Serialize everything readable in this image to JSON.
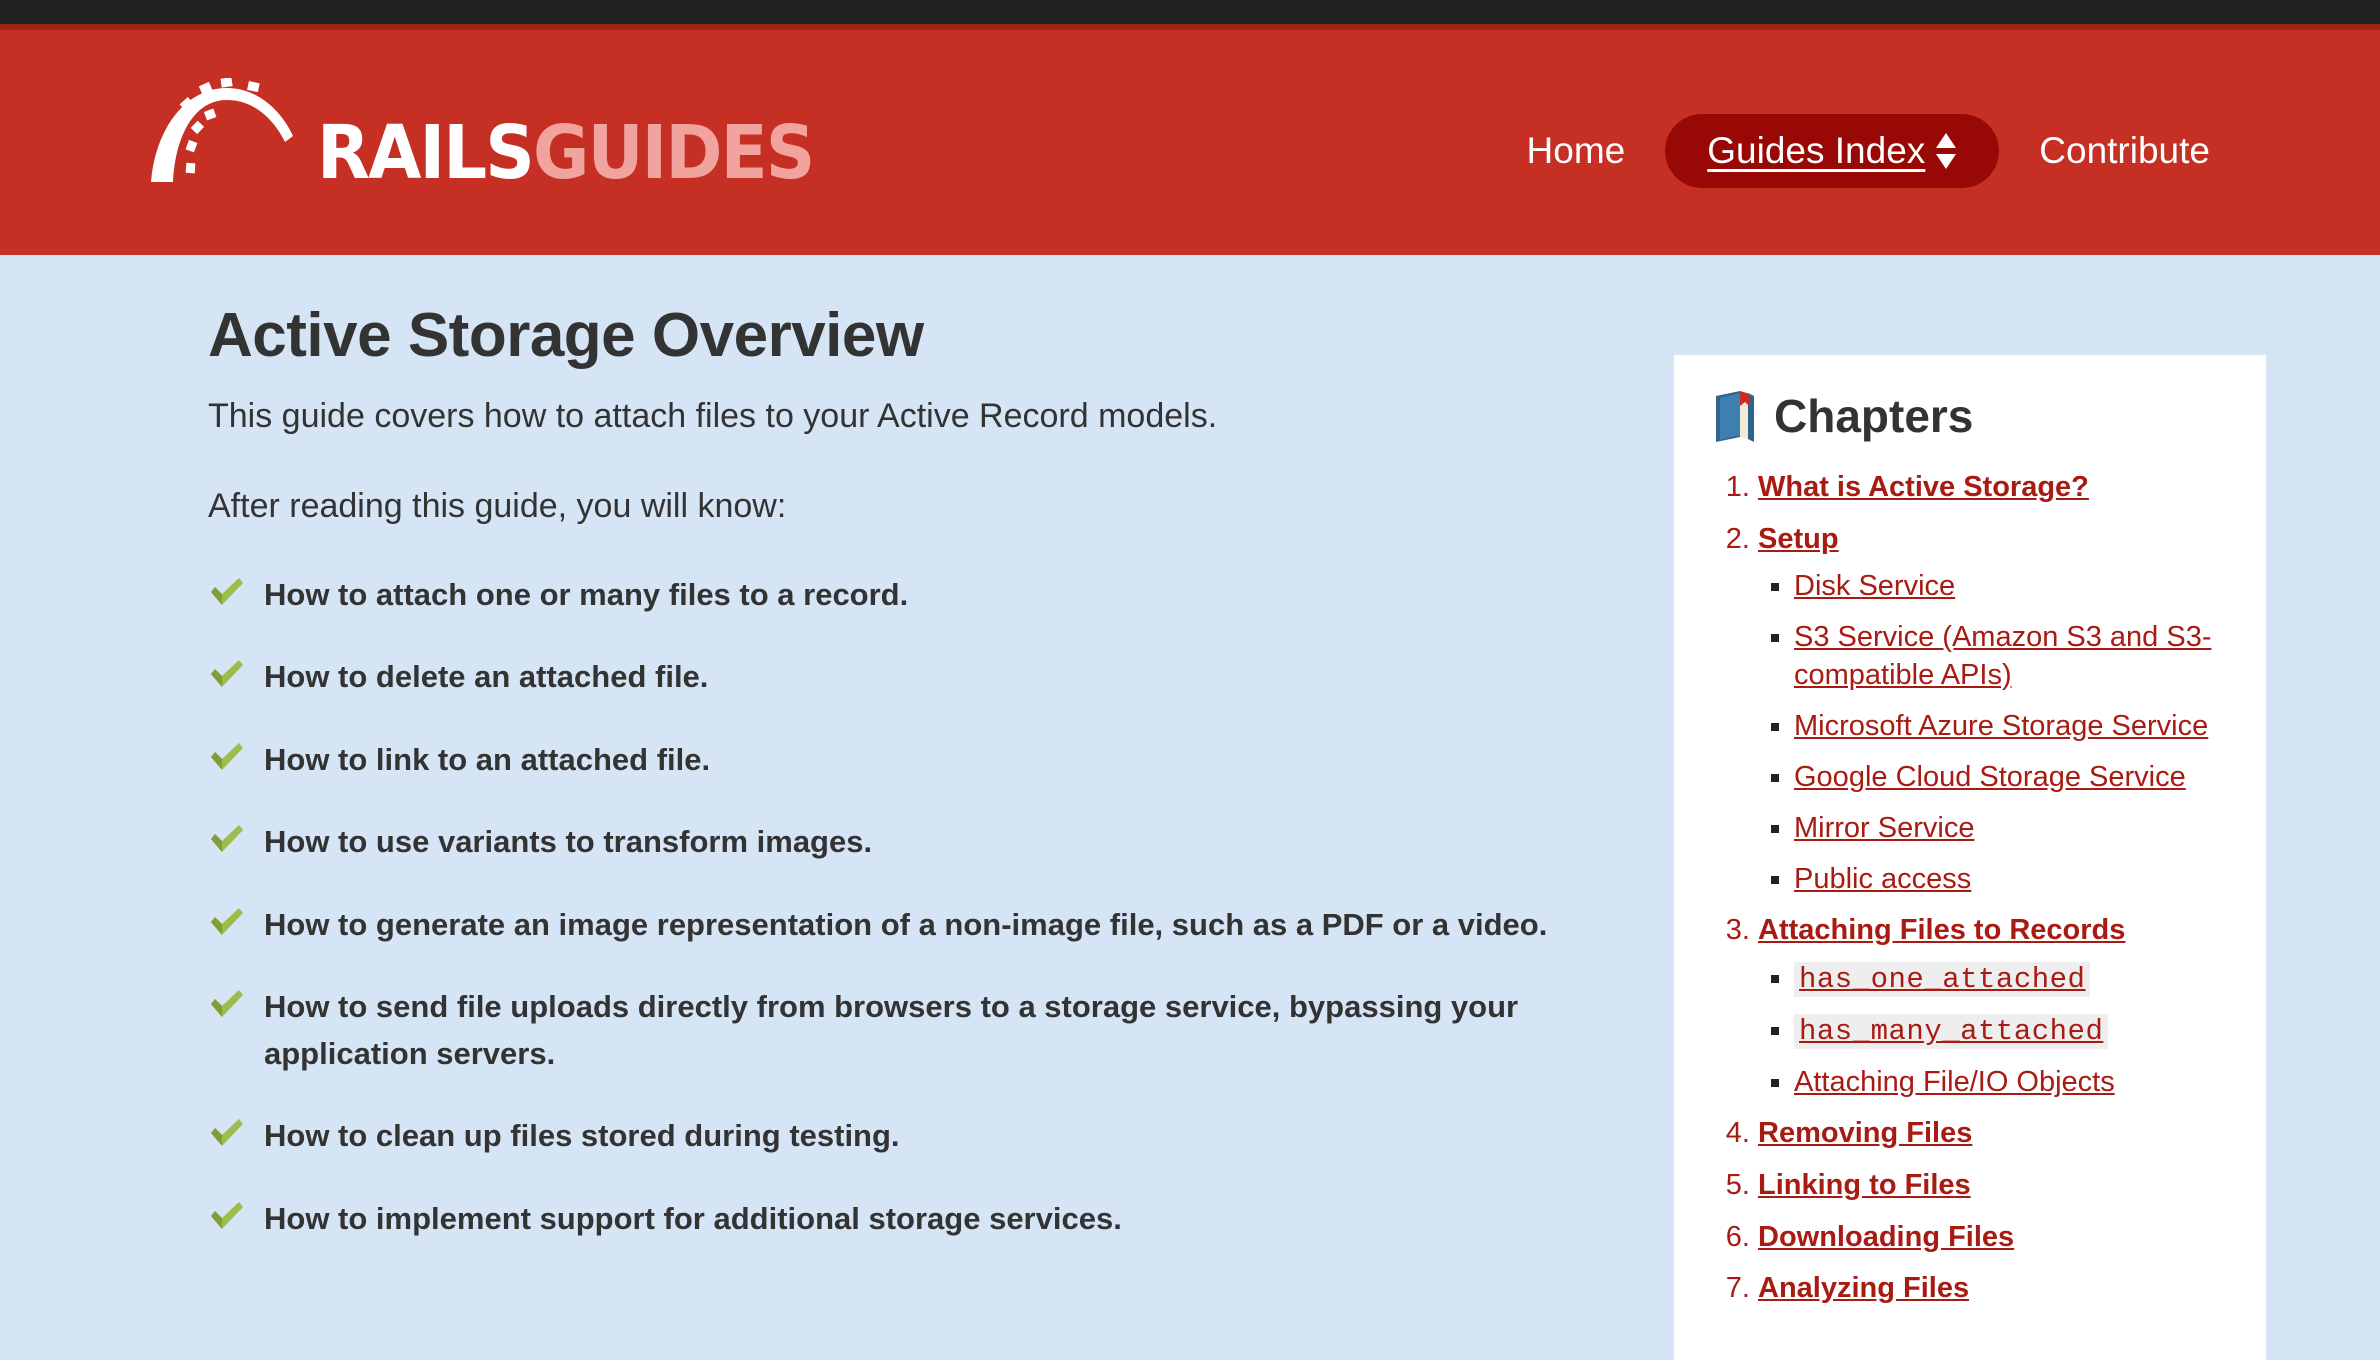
{
  "colors": {
    "header_red": "#c52f24",
    "header_accent": "#9e2418",
    "top_strip": "#222222",
    "pill_dark_red": "#980905",
    "page_background": "#d5e5f5",
    "panel_background": "#ffffff",
    "link_red": "#a81b13",
    "text_dark": "#333333",
    "logo_guides_pink": "#f1a39e",
    "code_background": "#eeeeee",
    "check_green": "#8cb440"
  },
  "header": {
    "logo": {
      "icon": "rails-arch-logo",
      "text_primary": "RAILS",
      "text_secondary": "GUIDES"
    },
    "nav": {
      "home_label": "Home",
      "guides_index_label": "Guides Index",
      "guides_index_icon": "sort-up-down-icon",
      "contribute_label": "Contribute"
    }
  },
  "main": {
    "title": "Active Storage Overview",
    "lede": "This guide covers how to attach files to your Active Record models.",
    "intro_line": "After reading this guide, you will know:",
    "check_icon": "green-check-icon",
    "objectives": [
      "How to attach one or many files to a record.",
      "How to delete an attached file.",
      "How to link to an attached file.",
      "How to use variants to transform images.",
      "How to generate an image representation of a non-image file, such as a PDF or a video.",
      "How to send file uploads directly from browsers to a storage service, bypassing your application servers.",
      "How to clean up files stored during testing.",
      "How to implement support for additional storage services."
    ]
  },
  "chapters": {
    "icon": "blue-book-icon",
    "title": "Chapters",
    "items": [
      {
        "number": "1",
        "label": "What is Active Storage?",
        "children": []
      },
      {
        "number": "2",
        "label": "Setup",
        "children": [
          {
            "label": "Disk Service",
            "code": false
          },
          {
            "label": "S3 Service (Amazon S3 and S3-compatible APIs)",
            "code": false
          },
          {
            "label": "Microsoft Azure Storage Service",
            "code": false
          },
          {
            "label": "Google Cloud Storage Service",
            "code": false
          },
          {
            "label": "Mirror Service",
            "code": false
          },
          {
            "label": "Public access",
            "code": false
          }
        ]
      },
      {
        "number": "3",
        "label": "Attaching Files to Records",
        "children": [
          {
            "label": "has_one_attached",
            "code": true
          },
          {
            "label": "has_many_attached",
            "code": true
          },
          {
            "label": "Attaching File/IO Objects",
            "code": false
          }
        ]
      },
      {
        "number": "4",
        "label": "Removing Files",
        "children": []
      },
      {
        "number": "5",
        "label": "Linking to Files",
        "children": []
      },
      {
        "number": "6",
        "label": "Downloading Files",
        "children": []
      },
      {
        "number": "7",
        "label": "Analyzing Files",
        "children": []
      }
    ]
  }
}
